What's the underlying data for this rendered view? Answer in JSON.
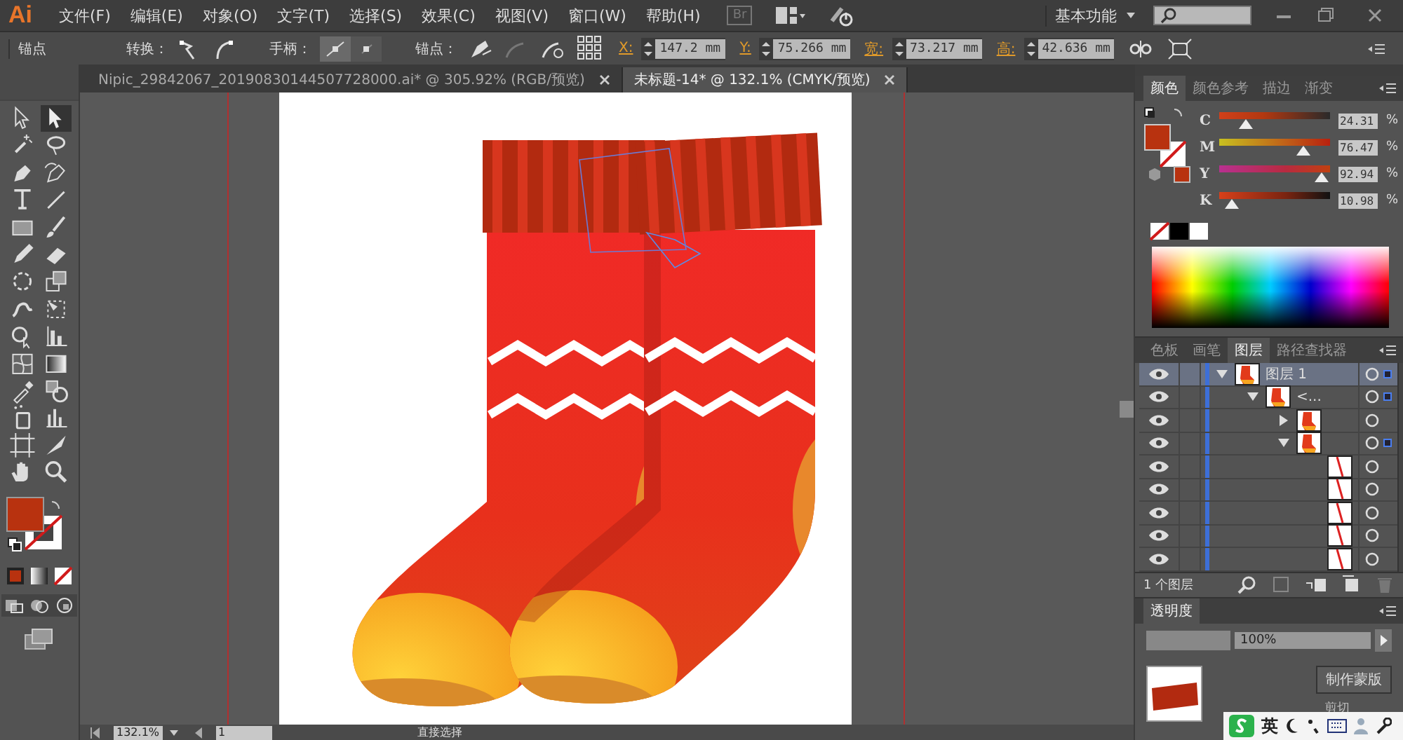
{
  "menu_bar": {
    "logo": "Ai",
    "menus": [
      "文件(F)",
      "编辑(E)",
      "对象(O)",
      "文字(T)",
      "选择(S)",
      "效果(C)",
      "视图(V)",
      "窗口(W)",
      "帮助(H)"
    ],
    "bridge_button": "Br",
    "workspace": "基本功能"
  },
  "control_bar": {
    "selection": "锚点",
    "convert_label": "转换：",
    "handles_label": "手柄：",
    "anchors_label": "锚点：",
    "fields": [
      {
        "label": "X:",
        "value": "147.2 mm"
      },
      {
        "label": "Y:",
        "value": "75.266 mm"
      },
      {
        "label": "宽:",
        "value": "73.217 mm"
      },
      {
        "label": "高:",
        "value": "42.636 mm"
      }
    ]
  },
  "doc_tabs": [
    {
      "title": "Nipic_29842067_20190830144507728000.ai* @ 305.92% (RGB/预览)",
      "selected": false
    },
    {
      "title": "未标题-14* @ 132.1% (CMYK/预览)",
      "selected": true
    }
  ],
  "tools": [
    {
      "selected": false
    },
    {
      "selected": true
    },
    {
      "selected": false
    },
    {
      "selected": false
    },
    {
      "selected": false
    },
    {
      "selected": false
    },
    {
      "selected": false
    },
    {
      "selected": false
    },
    {
      "selected": false
    },
    {
      "selected": false
    },
    {
      "selected": false
    },
    {
      "selected": false
    },
    {
      "selected": false
    },
    {
      "selected": false
    },
    {
      "selected": false
    },
    {
      "selected": false
    },
    {
      "selected": false
    },
    {
      "selected": false
    },
    {
      "selected": false
    },
    {
      "selected": false
    },
    {
      "selected": false
    },
    {
      "selected": false
    },
    {
      "selected": false
    },
    {
      "selected": false
    },
    {
      "selected": false
    },
    {
      "selected": false
    },
    {
      "selected": false
    },
    {
      "selected": false
    }
  ],
  "color_panel": {
    "tabs": [
      {
        "label": "颜色",
        "selected": true
      },
      {
        "label": "颜色参考",
        "selected": false
      },
      {
        "label": "描边",
        "selected": false
      },
      {
        "label": "渐变",
        "selected": false
      }
    ],
    "sliders": [
      {
        "name": "C",
        "level": 0.2431,
        "reading": "24.31",
        "unit": "%"
      },
      {
        "name": "M",
        "level": 0.7647,
        "reading": "76.47",
        "unit": "%"
      },
      {
        "name": "Y",
        "level": 0.9294,
        "reading": "92.94",
        "unit": "%"
      },
      {
        "name": "K",
        "level": 0.1098,
        "reading": "10.98",
        "unit": "%"
      }
    ]
  },
  "layers_panel": {
    "tabs": [
      {
        "label": "色板",
        "selected": false
      },
      {
        "label": "画笔",
        "selected": false
      },
      {
        "label": "图层",
        "selected": true
      },
      {
        "label": "路径查找器",
        "selected": false
      }
    ],
    "layers": [
      {
        "name": "图层 1",
        "kind": "group",
        "selected": true,
        "expanded": true,
        "has_selection": true,
        "children": [
          {
            "name": "<...",
            "kind": "group",
            "selected": false,
            "expanded": true,
            "has_selection": true,
            "children": [
              {
                "kind": "group",
                "selected": false,
                "expanded": false,
                "has_selection": false
              },
              {
                "kind": "group",
                "selected": false,
                "expanded": true,
                "has_selection": true,
                "children": [
                  {
                    "kind": "path",
                    "selected": false,
                    "has_selection": false
                  },
                  {
                    "kind": "path",
                    "selected": false,
                    "has_selection": false
                  },
                  {
                    "kind": "path",
                    "selected": false,
                    "has_selection": false
                  },
                  {
                    "kind": "path",
                    "selected": false,
                    "has_selection": false
                  },
                  {
                    "kind": "path",
                    "selected": false,
                    "has_selection": false
                  }
                ]
              }
            ]
          }
        ]
      }
    ],
    "footer": "1 个图层"
  },
  "transparency_panel": {
    "title": "透明度",
    "opacity": "100%",
    "mask_button": "制作蒙版",
    "clip_label": "剪切"
  },
  "status_bar": {
    "zoom": "132.1%",
    "artboard": "1",
    "tool": "直接选择"
  },
  "ime_bar": {
    "mode": "英"
  }
}
